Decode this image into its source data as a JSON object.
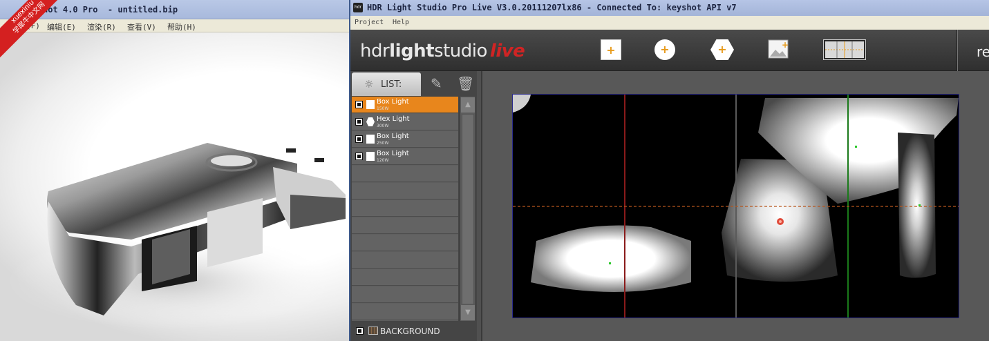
{
  "keyshot": {
    "title": "hot 4.0 Pro  - untitled.bip",
    "menu": [
      {
        "label": "(F)"
      },
      {
        "label": "编辑(E)"
      },
      {
        "label": "渲染(R)"
      },
      {
        "label": "查看(V)"
      },
      {
        "label": "帮助(H)"
      }
    ],
    "watermark_line1": "xuexiniu",
    "watermark_line2": "学犀牛中文网"
  },
  "hdr": {
    "title": "HDR Light Studio Pro Live V3.0.20111207lx86 - Connected To: keyshot API v7",
    "menu": [
      {
        "label": "Project"
      },
      {
        "label": "Help"
      }
    ],
    "brand": {
      "part1": "hdr",
      "part2": "light",
      "part3": "studio",
      "live": "live"
    },
    "toolbar_right": "re",
    "list_tab": "LIST:",
    "lights": [
      {
        "name": "Box Light",
        "watts": "150W",
        "shape": "box",
        "selected": true
      },
      {
        "name": "Hex Light",
        "watts": "300W",
        "shape": "hex",
        "selected": false
      },
      {
        "name": "Box Light",
        "watts": "250W",
        "shape": "box",
        "selected": false
      },
      {
        "name": "Box Light",
        "watts": "120W",
        "shape": "box",
        "selected": false
      }
    ],
    "background_label": "BACKGROUND"
  },
  "colors": {
    "accent": "#e8861c",
    "brand_live": "#d02424",
    "panel": "#505050"
  },
  "icons": [
    "bulb-icon",
    "edit-icon",
    "trash-icon",
    "add-box-light-icon",
    "add-circle-light-icon",
    "add-hex-light-icon",
    "add-image-light-icon",
    "preset-strip-icon"
  ]
}
